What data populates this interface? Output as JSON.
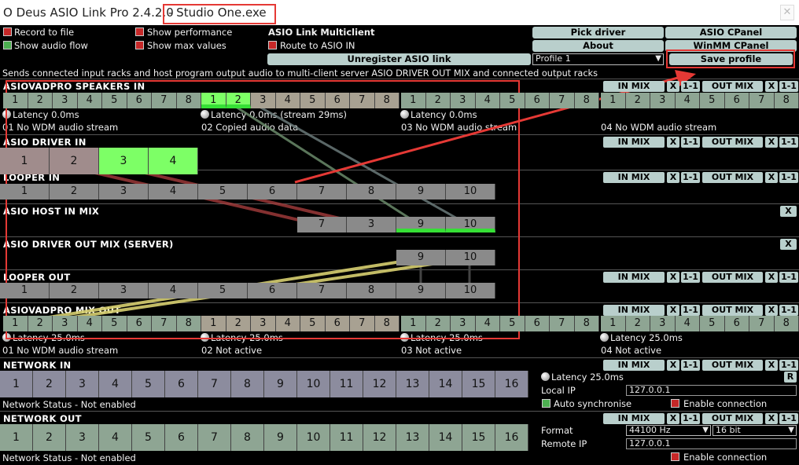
{
  "window": {
    "title_main": "O Deus ASIO Link Pro 2.4.2.0",
    "title_exe": "- Studio One.exe",
    "close_glyph": "✕"
  },
  "options": {
    "record_to_file": "Record to file",
    "show_audio_flow": "Show audio flow",
    "show_performance": "Show performance",
    "show_max_values": "Show max values",
    "multiclient_heading": "ASIO Link Multiclient",
    "route_to_asio_in": "Route to ASIO IN"
  },
  "buttons": {
    "pick_driver": "Pick driver",
    "asio_cpanel": "ASIO CPanel",
    "about": "About",
    "winmm_cpanel": "WinMM CPanel",
    "unregister": "Unregister ASIO link",
    "save_profile": "Save profile",
    "in_mix": "IN MIX",
    "x": "X",
    "one_one": "1-1",
    "out_mix": "OUT MIX"
  },
  "profile": {
    "selected": "Profile 1",
    "arrow": "▼"
  },
  "description": "Sends connected input racks and host program output audio to multi-client server ASIO DRIVER OUT MIX and connected output racks",
  "sections": {
    "speakers_in": "ASIOVADPRO SPEAKERS IN",
    "driver_in": "ASIO DRIVER IN",
    "looper_in": "LOOPER IN",
    "host_in_mix": "ASIO HOST IN MIX",
    "driver_out_mix": "ASIO DRIVER OUT MIX (SERVER)",
    "looper_out": "LOOPER OUT",
    "mix_out": "ASIOVADPRO MIX OUT",
    "network_in": "NETWORK IN",
    "network_out": "NETWORK OUT"
  },
  "channels": {
    "n1": "1",
    "n2": "2",
    "n3": "3",
    "n4": "4",
    "n5": "5",
    "n6": "6",
    "n7": "7",
    "n8": "8",
    "n9": "9",
    "n10": "10",
    "n11": "11",
    "n12": "12",
    "n13": "13",
    "n14": "14",
    "n15": "15",
    "n16": "16"
  },
  "speakers_in_status": {
    "latency_1": "Latency 0.0ms",
    "latency_2": "Latency 0.0ms (stream 29ms)",
    "latency_3": "Latency 0.0ms",
    "stream_1": "01 No WDM audio stream",
    "stream_2": "02 Copied audio data",
    "stream_3": "03 No WDM audio stream",
    "stream_4": "04 No WDM audio stream"
  },
  "mix_out_status": {
    "latency_1": "Latency 25.0ms",
    "latency_2": "Latency 25.0ms",
    "latency_3": "Latency 25.0ms",
    "latency_4": "Latency 25.0ms",
    "stream_1": "01 No WDM audio stream",
    "stream_2": "02 Not active",
    "stream_3": "03 Not active",
    "stream_4": "04 Not active"
  },
  "network_in_panel": {
    "latency": "Latency 25.0ms",
    "r": "R",
    "local_ip_label": "Local IP",
    "local_ip": "127.0.0.1",
    "auto_sync": "Auto synchronise",
    "enable_connection": "Enable connection",
    "status": "Network Status - Not enabled"
  },
  "network_out_panel": {
    "format_label": "Format",
    "sample_rate": "44100 Hz",
    "bit_depth": "16 bit",
    "remote_ip_label": "Remote IP",
    "remote_ip": "127.0.0.1",
    "enable_connection": "Enable connection",
    "status": "Network Status - Not enabled"
  },
  "colors": {
    "annotation_red": "#e53935",
    "active_green": "#7dff66",
    "button": "#b9cfcc",
    "route_yellow": "#d8d070"
  }
}
